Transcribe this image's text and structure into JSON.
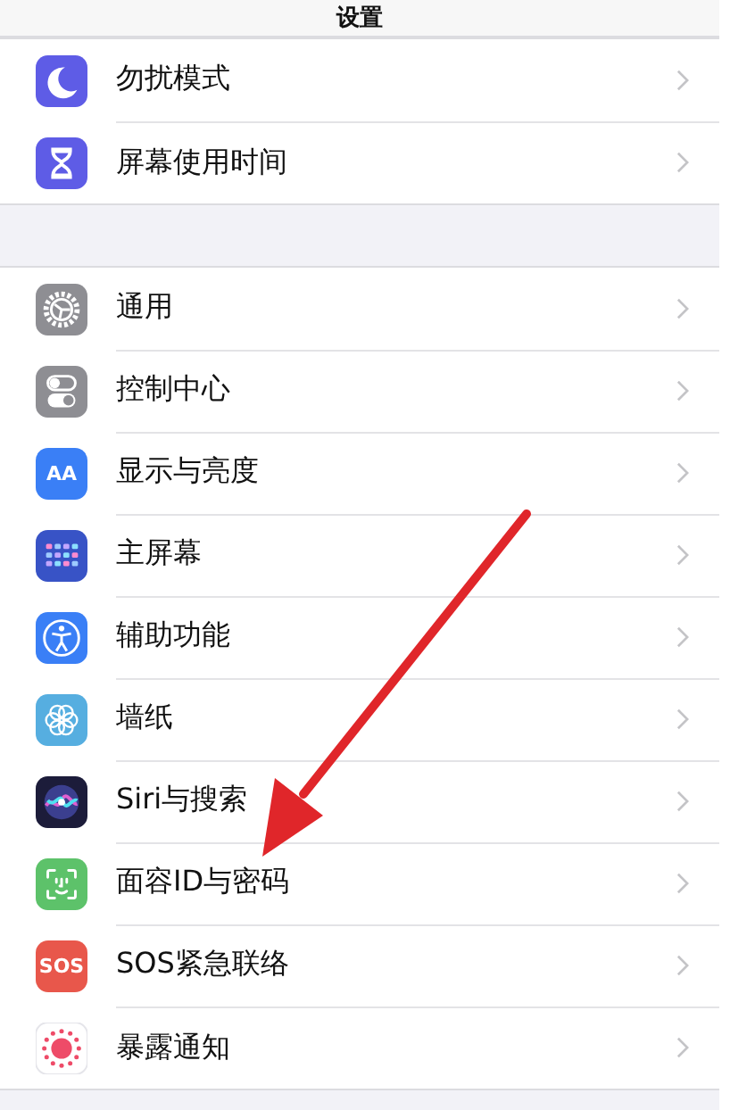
{
  "nav": {
    "title": "设置"
  },
  "groups": [
    {
      "items": [
        {
          "label": "勿扰模式",
          "kind": "moon"
        },
        {
          "label": "屏幕使用时间",
          "kind": "hourglass"
        }
      ]
    },
    {
      "items": [
        {
          "label": "通用",
          "kind": "gear"
        },
        {
          "label": "控制中心",
          "kind": "toggles"
        },
        {
          "label": "显示与亮度",
          "kind": "letters",
          "icon_text": "AA"
        },
        {
          "label": "主屏幕",
          "kind": "grid"
        },
        {
          "label": "辅助功能",
          "kind": "accessibility"
        },
        {
          "label": "墙纸",
          "kind": "flower"
        },
        {
          "label": "Siri与搜索",
          "kind": "siri"
        },
        {
          "label": "面容ID与密码",
          "kind": "face"
        },
        {
          "label": "SOS紧急联络",
          "kind": "letters",
          "icon_text": "SOS",
          "color": "#e8574b"
        },
        {
          "label": "暴露通知",
          "kind": "exposure"
        }
      ]
    }
  ],
  "annotation": {
    "kind": "arrow"
  }
}
